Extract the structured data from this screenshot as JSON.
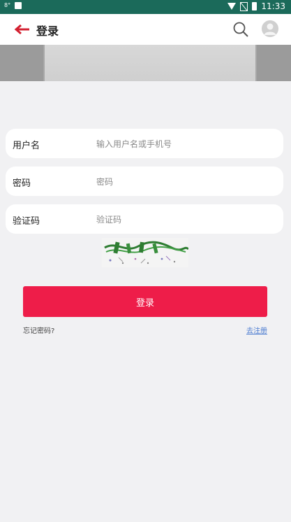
{
  "status_bar": {
    "time": "11:33",
    "left_indicator": "8°"
  },
  "header": {
    "title": "登录"
  },
  "form": {
    "username": {
      "label": "用户名",
      "placeholder": "输入用户名或手机号"
    },
    "password": {
      "label": "密码",
      "placeholder": "密码"
    },
    "captcha": {
      "label": "验证码",
      "placeholder": "验证码"
    }
  },
  "actions": {
    "login_label": "登录",
    "forgot_label": "忘记密码?",
    "register_label": "去注册"
  },
  "colors": {
    "status_bar": "#1b6a5a",
    "accent": "#ee1d49",
    "link": "#4b7bd0",
    "page_bg": "#f1f1f3"
  },
  "icons": {
    "back": "back-arrow-icon",
    "search": "search-icon",
    "avatar": "user-avatar-icon",
    "wifi": "wifi-icon",
    "signal": "no-signal-icon",
    "battery": "battery-icon"
  }
}
